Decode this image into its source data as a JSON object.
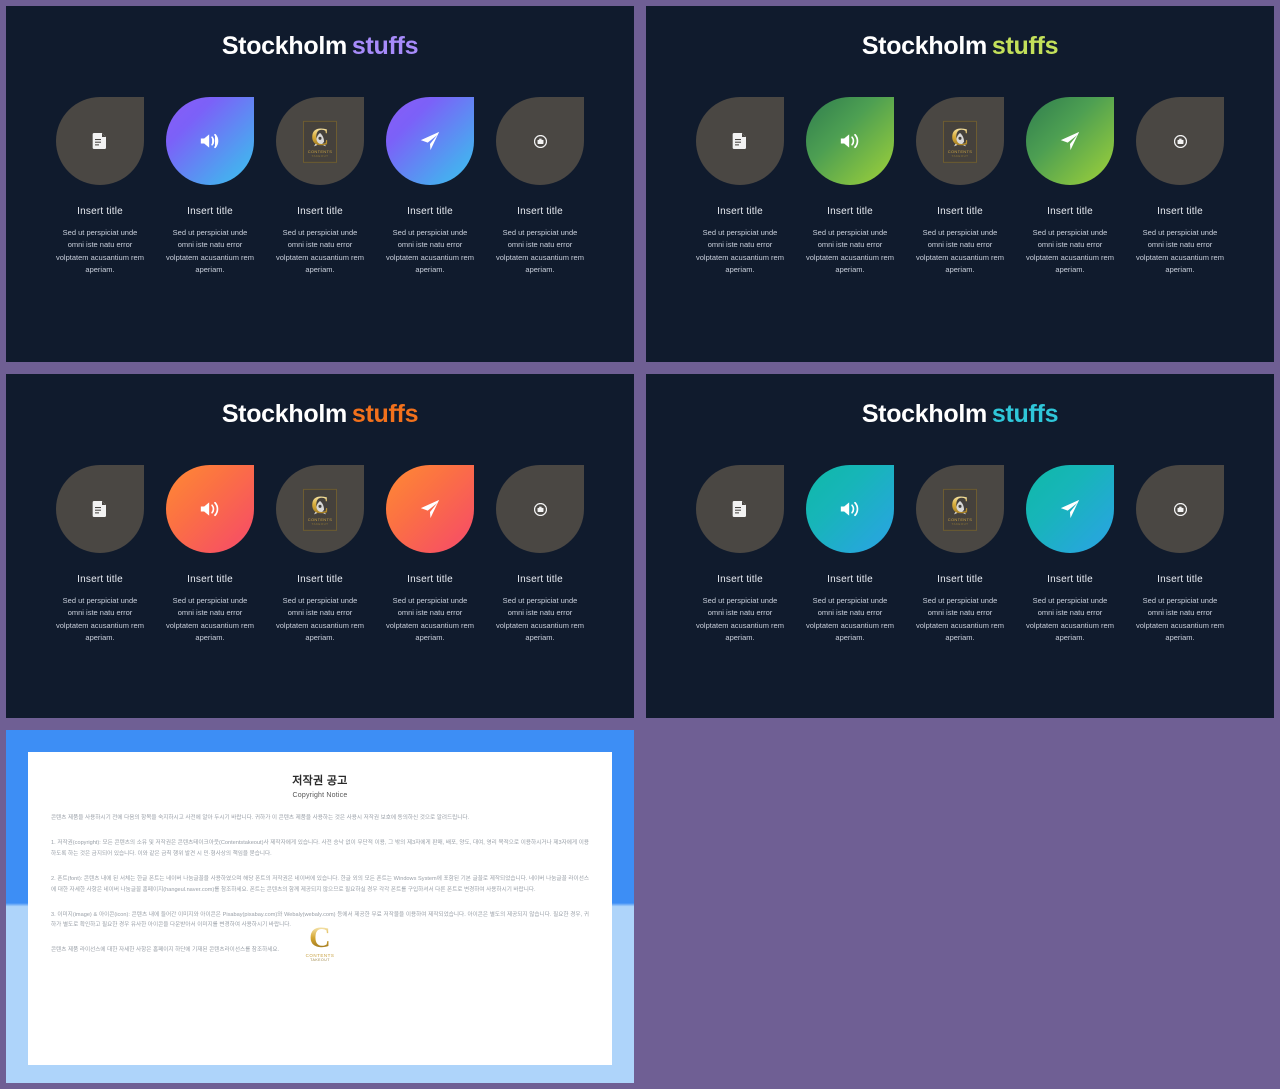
{
  "background_color": "#6f5f94",
  "slide_background": "#101b2d",
  "slides": [
    {
      "id": "slide-purple",
      "title_main": "Stockholm",
      "title_accent": "stuffs",
      "accent_color": "#a78bfa",
      "gradient_name": "purple-blue",
      "gradient_from": "#8a5cf6",
      "gradient_to": "#3fc0f0",
      "cards": [
        {
          "icon": "document-edit-icon",
          "highlight": false,
          "title": "Insert title",
          "body": "Sed ut perspiciat unde omni iste natu error volptatem acusantium rem aperiam."
        },
        {
          "icon": "speaker-volume-icon",
          "highlight": true,
          "title": "Insert title",
          "body": "Sed ut perspiciat unde omni iste natu error volptatem acusantium rem aperiam."
        },
        {
          "icon": "rocket-icon",
          "highlight": false,
          "watermarked": true,
          "title": "Insert title",
          "body": "Sed ut perspiciat unde omni iste natu error volptatem acusantium rem aperiam."
        },
        {
          "icon": "paper-plane-icon",
          "highlight": true,
          "title": "Insert title",
          "body": "Sed ut perspiciat unde omni iste natu error volptatem acusantium rem aperiam."
        },
        {
          "icon": "camera-icon",
          "highlight": false,
          "title": "Insert title",
          "body": "Sed ut perspiciat unde omni iste natu error volptatem acusantium rem aperiam."
        }
      ]
    },
    {
      "id": "slide-green",
      "title_main": "Stockholm",
      "title_accent": "stuffs",
      "accent_color": "#c3e05a",
      "gradient_name": "green-lime",
      "gradient_from": "#2f7d4e",
      "gradient_to": "#a8d24b",
      "cards": [
        {
          "icon": "document-edit-icon",
          "highlight": false,
          "title": "Insert title",
          "body": "Sed ut perspiciat unde omni iste natu error volptatem acusantium rem aperiam."
        },
        {
          "icon": "speaker-volume-icon",
          "highlight": true,
          "title": "Insert title",
          "body": "Sed ut perspiciat unde omni iste natu error volptatem acusantium rem aperiam."
        },
        {
          "icon": "rocket-icon",
          "highlight": false,
          "watermarked": true,
          "title": "Insert title",
          "body": "Sed ut perspiciat unde omni iste natu error volptatem acusantium rem aperiam."
        },
        {
          "icon": "paper-plane-icon",
          "highlight": true,
          "title": "Insert title",
          "body": "Sed ut perspiciat unde omni iste natu error volptatem acusantium rem aperiam."
        },
        {
          "icon": "camera-icon",
          "highlight": false,
          "title": "Insert title",
          "body": "Sed ut perspiciat unde omni iste natu error volptatem acusantium rem aperiam."
        }
      ]
    },
    {
      "id": "slide-orange",
      "title_main": "Stockholm",
      "title_accent": "stuffs",
      "accent_color": "#f2711c",
      "gradient_name": "orange-pink",
      "gradient_from": "#ff8a33",
      "gradient_to": "#f45b73",
      "cards": [
        {
          "icon": "document-edit-icon",
          "highlight": false,
          "title": "Insert title",
          "body": "Sed ut perspiciat unde omni iste natu error volptatem acusantium rem aperiam."
        },
        {
          "icon": "speaker-volume-icon",
          "highlight": true,
          "title": "Insert title",
          "body": "Sed ut perspiciat unde omni iste natu error volptatem acusantium rem aperiam."
        },
        {
          "icon": "rocket-icon",
          "highlight": false,
          "watermarked": true,
          "title": "Insert title",
          "body": "Sed ut perspiciat unde omni iste natu error volptatem acusantium rem aperiam."
        },
        {
          "icon": "paper-plane-icon",
          "highlight": true,
          "title": "Insert title",
          "body": "Sed ut perspiciat unde omni iste natu error volptatem acusantium rem aperiam."
        },
        {
          "icon": "camera-icon",
          "highlight": false,
          "title": "Insert title",
          "body": "Sed ut perspiciat unde omni iste natu error volptatem acusantium rem aperiam."
        }
      ]
    },
    {
      "id": "slide-teal",
      "title_main": "Stockholm",
      "title_accent": "stuffs",
      "accent_color": "#2fc7d9",
      "gradient_name": "teal-blue",
      "gradient_from": "#0fb9a8",
      "gradient_to": "#28a3e0",
      "cards": [
        {
          "icon": "document-edit-icon",
          "highlight": false,
          "title": "Insert title",
          "body": "Sed ut perspiciat unde omni iste natu error volptatem acusantium rem aperiam."
        },
        {
          "icon": "speaker-volume-icon",
          "highlight": true,
          "title": "Insert title",
          "body": "Sed ut perspiciat unde omni iste natu error volptatem acusantium rem aperiam."
        },
        {
          "icon": "rocket-icon",
          "highlight": false,
          "watermarked": true,
          "title": "Insert title",
          "body": "Sed ut perspiciat unde omni iste natu error volptatem acusantium rem aperiam."
        },
        {
          "icon": "paper-plane-icon",
          "highlight": true,
          "title": "Insert title",
          "body": "Sed ut perspiciat unde omni iste natu error volptatem acusantium rem aperiam."
        },
        {
          "icon": "camera-icon",
          "highlight": false,
          "title": "Insert title",
          "body": "Sed ut perspiciat unde omni iste natu error volptatem acusantium rem aperiam."
        }
      ]
    }
  ],
  "watermark": {
    "letter": "C",
    "sub1": "CONTENTS",
    "sub2": "TAKEOUT"
  },
  "copyright_doc": {
    "frame_color_top": "#3d8ef5",
    "frame_color_bottom": "#aed4fa",
    "heading": "저작권 공고",
    "subheading": "Copyright Notice",
    "paragraphs": [
      "콘텐츠 제품을 사용하시기 전에 다음의 항목을 숙지하시고 사전에 알아 두시기 바랍니다. 귀하가 이 콘텐츠 제품을 사용하는 것은 사용시 저작권 보호에 동의하신 것으로 알려드립니다.",
      "1. 저작권(copyright): 모든 콘텐츠의 소유 및 저작권은 콘텐츠테이크아웃(Contentstakeout)사 제작자에게 있습니다. 사전 승낙 없이 무단적 이용, 그 밖의 제3자에게 판매, 배포, 양도, 대여, 영리 목적으로 이용하시거나 제3자에게 이용하도록 하는 것은 금지되어 있습니다. 이와 같은 금칙 행위 발견 시 민·형사상의 책임을 묻습니다.",
      "2. 폰트(font): 콘텐츠 내에 된 서체는 한글 폰트는 네이버 나눔글꼴을 사용하였으며 해당 폰트의 저작권은 네이버에 있습니다. 한글 외의 모든 폰트는 Windows System에 포함된 기본 글꼴로 제작되었습니다. 네이버 나눔글꼴 라이선스에 대한 자세한 사항은 네이버 나눔글꼴 홈페이지(hangeul.naver.com)를 참조하세요. 폰트는 콘텐츠의 함께 제공되지 않으므로 필요하실 경우 각각 폰트를 구입하셔서 다른 폰트로 변경하여 사용하시기 바랍니다.",
      "3. 이미지(image) & 아이콘(icon): 콘텐츠 내에 들어간 이미지와 아이콘은 Pixabay(pixabay.com)와 Webaly(webaly.com) 등에서 제공한 무료 저작물을 이용하여 제작되었습니다. 아이콘은 별도의 제공되지 않습니다. 필요한 경우, 귀하가 별도로 확인하고 필요한 경우 유사한 아이콘을 다운받아서 이미지를 변경하여 사용하시기 바랍니다.",
      "콘텐츠 제품 라이선스에 대한 자세한 사항은 홈페이지 하단에 기재된 콘텐츠라이선스를 참조하세요."
    ]
  }
}
